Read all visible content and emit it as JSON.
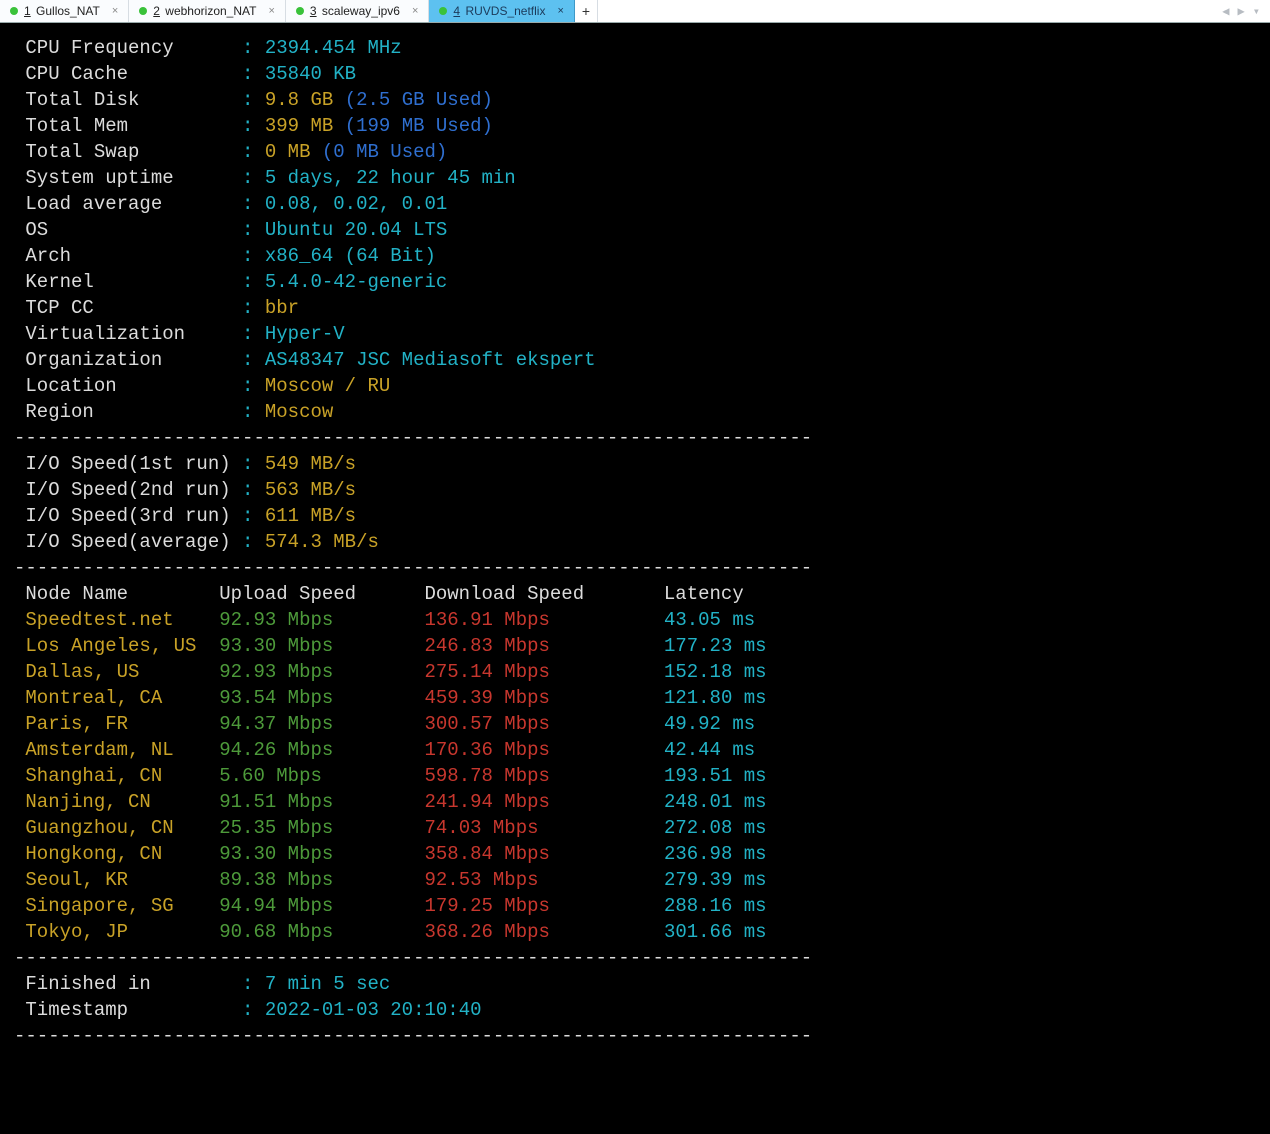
{
  "tabs": [
    {
      "num": "1",
      "label": "Gullos_NAT",
      "active": false
    },
    {
      "num": "2",
      "label": "webhorizon_NAT",
      "active": false
    },
    {
      "num": "3",
      "label": "scaleway_ipv6",
      "active": false
    },
    {
      "num": "4",
      "label": "RUVDS_netflix",
      "active": true
    }
  ],
  "newtab_label": "+",
  "arrows": {
    "left": "◀",
    "right": "▶",
    "down": "▾"
  },
  "divider": "----------------------------------------------------------------------",
  "colon": ":",
  "sys": {
    "cpu_freq": {
      "label": "CPU Frequency",
      "val": "2394.454 MHz"
    },
    "cpu_cache": {
      "label": "CPU Cache",
      "val": "35840 KB"
    },
    "total_disk": {
      "label": "Total Disk",
      "val": "9.8 GB",
      "paren": "(2.5 GB Used)"
    },
    "total_mem": {
      "label": "Total Mem",
      "val": "399 MB",
      "paren": "(199 MB Used)"
    },
    "total_swap": {
      "label": "Total Swap",
      "val": "0 MB",
      "paren": "(0 MB Used)"
    },
    "uptime": {
      "label": "System uptime",
      "val": "5 days, 22 hour 45 min"
    },
    "load": {
      "label": "Load average",
      "val": "0.08, 0.02, 0.01"
    },
    "os": {
      "label": "OS",
      "val": "Ubuntu 20.04 LTS"
    },
    "arch": {
      "label": "Arch",
      "val": "x86_64 (64 Bit)"
    },
    "kernel": {
      "label": "Kernel",
      "val": "5.4.0-42-generic"
    },
    "tcpcc": {
      "label": "TCP CC",
      "val": "bbr"
    },
    "virt": {
      "label": "Virtualization",
      "val": "Hyper-V"
    },
    "org": {
      "label": "Organization",
      "val": "AS48347 JSC Mediasoft ekspert"
    },
    "location": {
      "label": "Location",
      "val": "Moscow / RU"
    },
    "region": {
      "label": "Region",
      "val": "Moscow"
    }
  },
  "io": [
    {
      "label": "I/O Speed(1st run)",
      "val": "549 MB/s"
    },
    {
      "label": "I/O Speed(2nd run)",
      "val": "563 MB/s"
    },
    {
      "label": "I/O Speed(3rd run)",
      "val": "611 MB/s"
    },
    {
      "label": "I/O Speed(average)",
      "val": "574.3 MB/s"
    }
  ],
  "speed_header": {
    "node": "Node Name",
    "up": "Upload Speed",
    "down": "Download Speed",
    "lat": "Latency"
  },
  "speed": [
    {
      "node": "Speedtest.net",
      "up": "92.93 Mbps",
      "down": "136.91 Mbps",
      "lat": "43.05 ms"
    },
    {
      "node": "Los Angeles, US",
      "up": "93.30 Mbps",
      "down": "246.83 Mbps",
      "lat": "177.23 ms"
    },
    {
      "node": "Dallas, US",
      "up": "92.93 Mbps",
      "down": "275.14 Mbps",
      "lat": "152.18 ms"
    },
    {
      "node": "Montreal, CA",
      "up": "93.54 Mbps",
      "down": "459.39 Mbps",
      "lat": "121.80 ms"
    },
    {
      "node": "Paris, FR",
      "up": "94.37 Mbps",
      "down": "300.57 Mbps",
      "lat": "49.92 ms"
    },
    {
      "node": "Amsterdam, NL",
      "up": "94.26 Mbps",
      "down": "170.36 Mbps",
      "lat": "42.44 ms"
    },
    {
      "node": "Shanghai, CN",
      "up": "5.60 Mbps",
      "down": "598.78 Mbps",
      "lat": "193.51 ms"
    },
    {
      "node": "Nanjing, CN",
      "up": "91.51 Mbps",
      "down": "241.94 Mbps",
      "lat": "248.01 ms"
    },
    {
      "node": "Guangzhou, CN",
      "up": "25.35 Mbps",
      "down": "74.03 Mbps",
      "lat": "272.08 ms"
    },
    {
      "node": "Hongkong, CN",
      "up": "93.30 Mbps",
      "down": "358.84 Mbps",
      "lat": "236.98 ms"
    },
    {
      "node": "Seoul, KR",
      "up": "89.38 Mbps",
      "down": "92.53 Mbps",
      "lat": "279.39 ms"
    },
    {
      "node": "Singapore, SG",
      "up": "94.94 Mbps",
      "down": "179.25 Mbps",
      "lat": "288.16 ms"
    },
    {
      "node": "Tokyo, JP",
      "up": "90.68 Mbps",
      "down": "368.26 Mbps",
      "lat": "301.66 ms"
    }
  ],
  "footer": {
    "finished": {
      "label": "Finished in",
      "val": "7 min 5 sec"
    },
    "timestamp": {
      "label": "Timestamp",
      "val": "2022-01-03 20:10:40"
    }
  }
}
